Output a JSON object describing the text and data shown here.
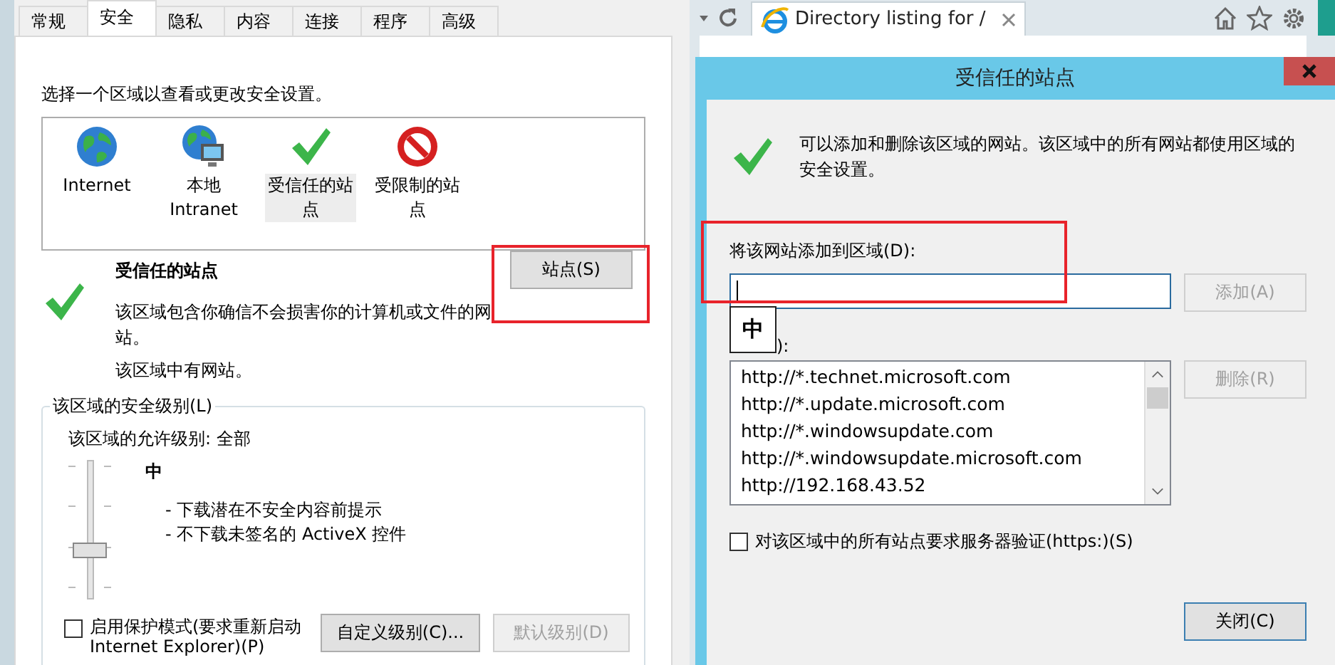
{
  "options_dialog": {
    "tabs": [
      {
        "label": "常规",
        "selected": false
      },
      {
        "label": "安全",
        "selected": true
      },
      {
        "label": "隐私",
        "selected": false
      },
      {
        "label": "内容",
        "selected": false
      },
      {
        "label": "连接",
        "selected": false
      },
      {
        "label": "程序",
        "selected": false
      },
      {
        "label": "高级",
        "selected": false
      }
    ],
    "zone_prompt": "选择一个区域以查看或更改安全设置。",
    "zones": [
      {
        "kind": "internet",
        "label": "Internet",
        "selected": false
      },
      {
        "kind": "intranet",
        "label": "本地 Intranet",
        "selected": false
      },
      {
        "kind": "trusted",
        "label": "受信任的站点",
        "selected": true
      },
      {
        "kind": "restricted",
        "label": "受限制的站点",
        "selected": false
      }
    ],
    "zone_title": "受信任的站点",
    "sites_button": "站点(S)",
    "zone_description": "该区域包含你确信不会损害你的计算机或文件的网站。",
    "zone_status": "该区域中有网站。",
    "security_level": {
      "legend": "该区域的安全级别(L)",
      "allowed": "该区域的允许级别: 全部",
      "level": 0.33,
      "level_name": "中",
      "bullets": [
        "- 下载潜在不安全内容前提示",
        "- 不下载未签名的 ActiveX 控件"
      ]
    },
    "protected_mode": {
      "label": "启用保护模式(要求重新启动 Internet Explorer)(P)",
      "checked": false
    },
    "buttons": [
      {
        "label": "自定义级别(C)...",
        "disabled": false
      },
      {
        "label": "默认级别(D)",
        "disabled": true
      }
    ]
  },
  "browser": {
    "tab_title": "Directory listing for /"
  },
  "sites_dialog": {
    "title": "受信任的站点",
    "info": "可以添加和删除该区域的网站。该区域中的所有网站都使用区域的安全设置。",
    "add_label": "将该网站添加到区域(D):",
    "add_button": {
      "label": "添加(A)",
      "disabled": true
    },
    "ime_indicator": "中",
    "list_label": "):",
    "sites": [
      "http://*.technet.microsoft.com",
      "http://*.update.microsoft.com",
      "http://*.windowsupdate.com",
      "http://*.windowsupdate.microsoft.com",
      "http://192.168.43.52"
    ],
    "remove_button": {
      "label": "删除(R)",
      "disabled": true
    },
    "require_https": {
      "label": "对该区域中的所有站点要求服务器验证(https:)(S)",
      "checked": false
    },
    "close_button": "关闭(C)"
  }
}
